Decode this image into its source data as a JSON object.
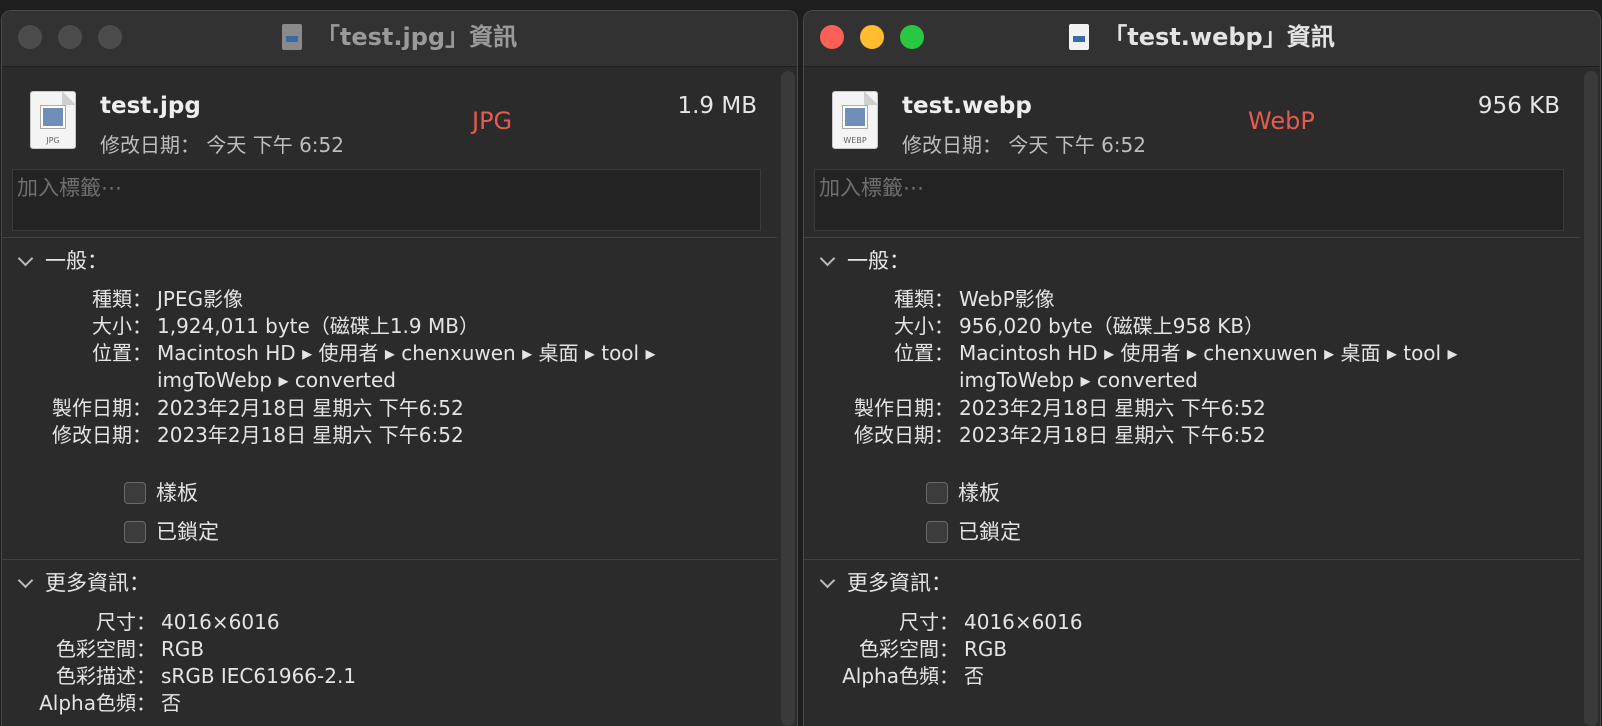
{
  "windows": [
    {
      "title": "「test.jpg」資訊",
      "file_name": "test.jpg",
      "modified_short": "修改日期： 今天 下午 6:52",
      "size_short": "1.9 MB",
      "format_label": "JPG",
      "icon_ext": "JPG",
      "tags_placeholder": "加入標籤⋯",
      "general": {
        "heading": "一般：",
        "kind_label": "種類：",
        "kind": "JPEG影像",
        "size_label": "大小：",
        "size": "1,924,011 byte（磁碟上1.9 MB）",
        "where_label": "位置：",
        "where_line1": "Macintosh HD ▸ 使用者 ▸ chenxuwen ▸ 桌面 ▸ tool ▸",
        "where_line2": "imgToWebp ▸ converted",
        "created_label": "製作日期：",
        "created": "2023年2月18日 星期六 下午6:52",
        "modified_label": "修改日期：",
        "modified": "2023年2月18日 星期六 下午6:52",
        "stationery_label": "樣板",
        "locked_label": "已鎖定"
      },
      "more_info": {
        "heading": "更多資訊：",
        "dimensions_label": "尺寸：",
        "dimensions": "4016×6016",
        "color_space_label": "色彩空間：",
        "color_space": "RGB",
        "color_profile_label": "色彩描述：",
        "color_profile": "sRGB IEC61966-2.1",
        "alpha_label": "Alpha色頻：",
        "alpha": "否"
      }
    },
    {
      "title": "「test.webp」資訊",
      "file_name": "test.webp",
      "modified_short": "修改日期： 今天 下午 6:52",
      "size_short": "956 KB",
      "format_label": "WebP",
      "icon_ext": "WEBP",
      "tags_placeholder": "加入標籤⋯",
      "general": {
        "heading": "一般：",
        "kind_label": "種類：",
        "kind": "WebP影像",
        "size_label": "大小：",
        "size": "956,020 byte（磁碟上958 KB）",
        "where_label": "位置：",
        "where_line1": "Macintosh HD ▸ 使用者 ▸ chenxuwen ▸ 桌面 ▸ tool ▸",
        "where_line2": "imgToWebp ▸ converted",
        "created_label": "製作日期：",
        "created": "2023年2月18日 星期六 下午6:52",
        "modified_label": "修改日期：",
        "modified": "2023年2月18日 星期六 下午6:52",
        "stationery_label": "樣板",
        "locked_label": "已鎖定"
      },
      "more_info": {
        "heading": "更多資訊：",
        "dimensions_label": "尺寸：",
        "dimensions": "4016×6016",
        "color_space_label": "色彩空間：",
        "color_space": "RGB",
        "alpha_label": "Alpha色頻：",
        "alpha": "否"
      }
    }
  ],
  "colors": {
    "format_label": "#e85a4f",
    "close": "#fe5f57",
    "minimize": "#febc2e",
    "zoom": "#28c840",
    "window_bg": "#2b2b2b"
  }
}
